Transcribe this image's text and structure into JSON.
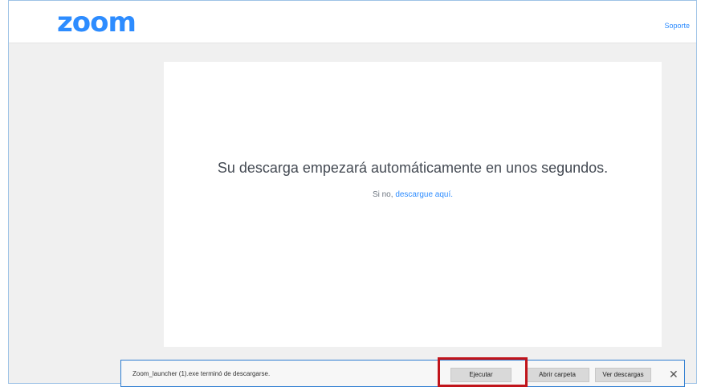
{
  "header": {
    "logo_text": "zoom",
    "support_link": "Soporte"
  },
  "main": {
    "headline": "Su descarga empezará automáticamente en unos segundos.",
    "fallback_prefix": "Si no,",
    "fallback_link": "descargue aquí."
  },
  "download_bar": {
    "status_text": "Zoom_launcher (1).exe terminó de descargarse.",
    "run_button": "Ejecutar",
    "open_folder_button": "Abrir carpeta",
    "view_downloads_button": "Ver descargas",
    "close_icon": "close-icon"
  },
  "colors": {
    "brand": "#2d8cff",
    "highlight": "#c0141b",
    "download_bar_border": "#2e7dd1"
  }
}
